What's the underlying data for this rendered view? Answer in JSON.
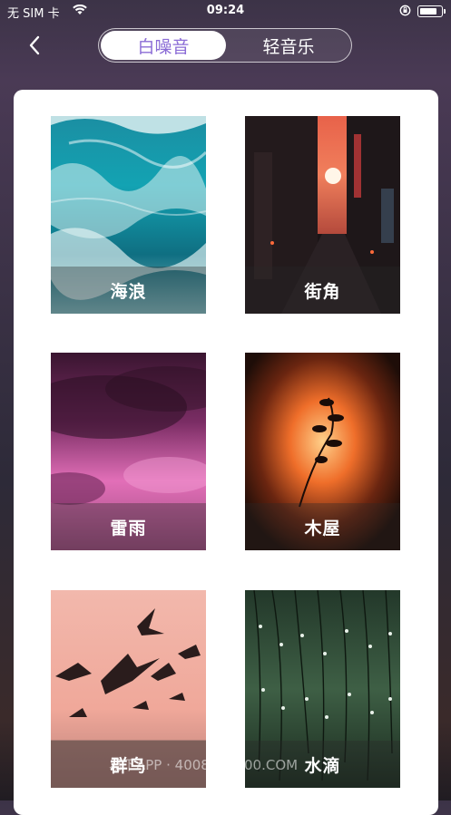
{
  "status_bar": {
    "carrier": "无 SIM 卡",
    "time": "09:24"
  },
  "header": {
    "back_icon": "chevron-left-icon",
    "tabs": [
      {
        "label": "白噪音",
        "active": true
      },
      {
        "label": "轻音乐",
        "active": false
      }
    ],
    "active_tab_color": "#8b6cd6"
  },
  "sounds": [
    {
      "label": "海浪"
    },
    {
      "label": "街角"
    },
    {
      "label": "雷雨"
    },
    {
      "label": "木屋"
    },
    {
      "label": "群鸟"
    },
    {
      "label": "水滴"
    }
  ],
  "watermark": "易下APP · 4008881800.COM"
}
